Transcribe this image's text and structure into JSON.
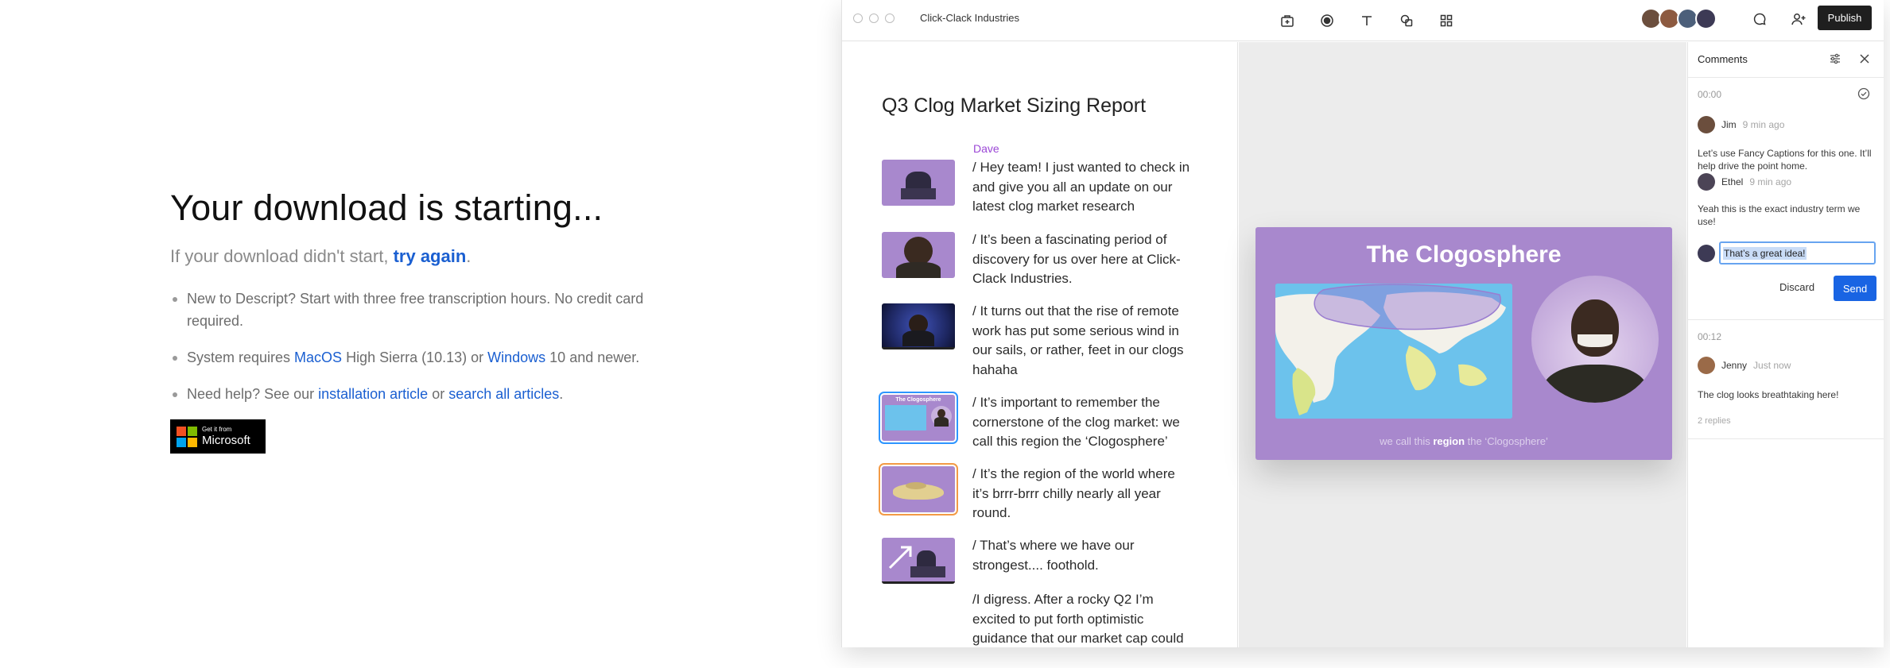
{
  "download": {
    "title": "Your download is starting...",
    "subtitle_prefix": "If your download didn't start, ",
    "try_again": "try again",
    "subtitle_suffix": ".",
    "bullet1": "New to Descript? Start with three free transcription hours. No credit card required.",
    "bullet2_a": "System requires ",
    "bullet2_macos": "MacOS",
    "bullet2_b": " High Sierra (10.13) or ",
    "bullet2_windows": "Windows",
    "bullet2_c": " 10 and newer.",
    "bullet3_a": "Need help? See our ",
    "bullet3_install": "installation article",
    "bullet3_b": " or ",
    "bullet3_search": "search all articles",
    "bullet3_c": ".",
    "badge_small": "Get it from",
    "badge_big": "Microsoft",
    "link_color": "#1a5fd1"
  },
  "app": {
    "project_name": "Click-Clack Industries",
    "publish_label": "Publish",
    "toolbar_icons": [
      "storyboard-icon",
      "record-icon",
      "text-icon",
      "shapes-icon",
      "grid-icon"
    ],
    "collaborator_colors": [
      "#6b4e3d",
      "#8d5a40",
      "#4c5f7a",
      "#3d3a55"
    ]
  },
  "script": {
    "title": "Q3 Clog Market Sizing Report",
    "speaker": "Dave",
    "speaker_color": "#9b47d6",
    "paragraphs": [
      "/ Hey team! I just wanted to check in and give you all an update on our latest clog market research",
      "/ It’s been a fascinating period of discovery for us over here at Click-Clack Industries.",
      "/ It turns out that the rise of remote work has put some serious wind in our sails, or rather, feet in our clogs hahaha",
      "/ It’s important to remember the cornerstone of the clog market: we call this region the ‘Clogosphere’",
      "/ It’s the region of the world where it’s brrr-brrr chilly nearly all year round.",
      "/ That’s where we have our strongest.... foothold.",
      "/I digress. After a rocky Q2 I’m excited to put forth optimistic guidance that our market cap could"
    ],
    "thumb4_title": "The Clogosphere"
  },
  "slide": {
    "title": "The Clogosphere",
    "caption_a": "we call this ",
    "caption_b": "region",
    "caption_c": " the ‘Clogosphere’",
    "bg_color": "#a888cd"
  },
  "comments": {
    "title": "Comments",
    "thread1": {
      "timestamp": "00:00",
      "c1_user": "Jim",
      "c1_time": "9 min ago",
      "c1_text": "Let’s use Fancy Captions for this one. It’ll help drive the point home.",
      "c2_user": "Ethel",
      "c2_time": "9 min ago",
      "c2_text": "Yeah this is the exact industry term we use!",
      "reply_value": "That’s a great idea!",
      "discard_label": "Discard",
      "send_label": "Send"
    },
    "thread2": {
      "timestamp": "00:12",
      "user": "Jenny",
      "time": "Just now",
      "text": "The clog looks breathtaking here!",
      "replies": "2 replies"
    },
    "send_color": "#1964e3"
  }
}
